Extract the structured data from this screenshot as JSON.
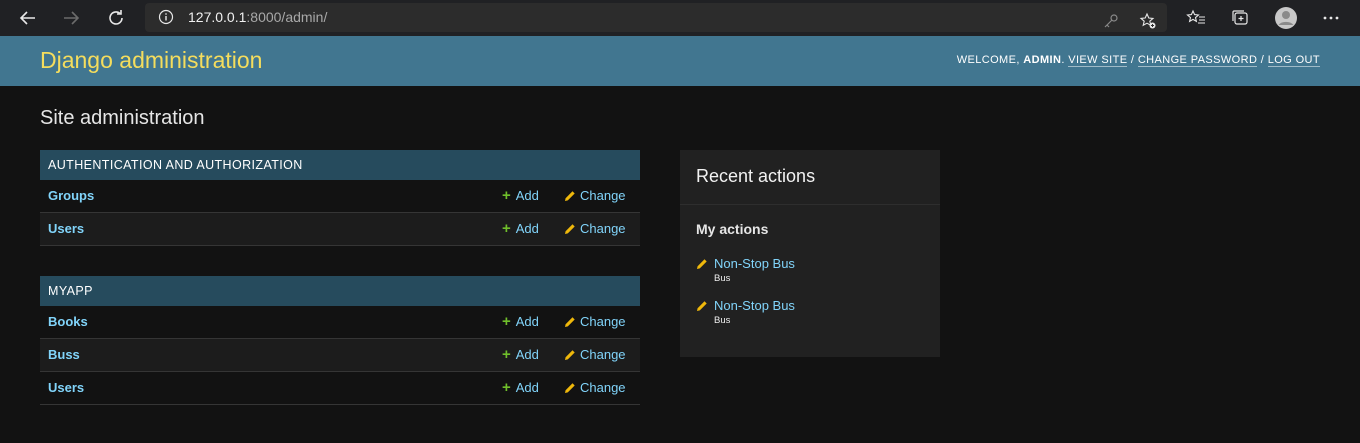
{
  "browser": {
    "url_host": "127.0.0.1",
    "url_rest": ":8000/admin/"
  },
  "header": {
    "brand": "Django administration",
    "welcome": "WELCOME, ",
    "username": "ADMIN",
    "view_site": "VIEW SITE",
    "change_password": "CHANGE PASSWORD",
    "log_out": "LOG OUT"
  },
  "page_title": "Site administration",
  "modules": [
    {
      "caption": "AUTHENTICATION AND AUTHORIZATION",
      "rows": [
        {
          "name": "Groups",
          "add": "Add",
          "change": "Change"
        },
        {
          "name": "Users",
          "add": "Add",
          "change": "Change"
        }
      ]
    },
    {
      "caption": "MYAPP",
      "rows": [
        {
          "name": "Books",
          "add": "Add",
          "change": "Change"
        },
        {
          "name": "Buss",
          "add": "Add",
          "change": "Change"
        },
        {
          "name": "Users",
          "add": "Add",
          "change": "Change"
        }
      ]
    }
  ],
  "recent_actions": {
    "title": "Recent actions",
    "subtitle": "My actions",
    "items": [
      {
        "label": "Non-Stop Bus",
        "type": "Bus"
      },
      {
        "label": "Non-Stop Bus",
        "type": "Bus"
      }
    ]
  },
  "colors": {
    "header_bg": "#417690",
    "brand": "#f5dd5d",
    "caption_bg": "#264b5d",
    "link": "#81d4fa",
    "add_icon": "#70bf2b",
    "change_icon": "#efb80b"
  }
}
